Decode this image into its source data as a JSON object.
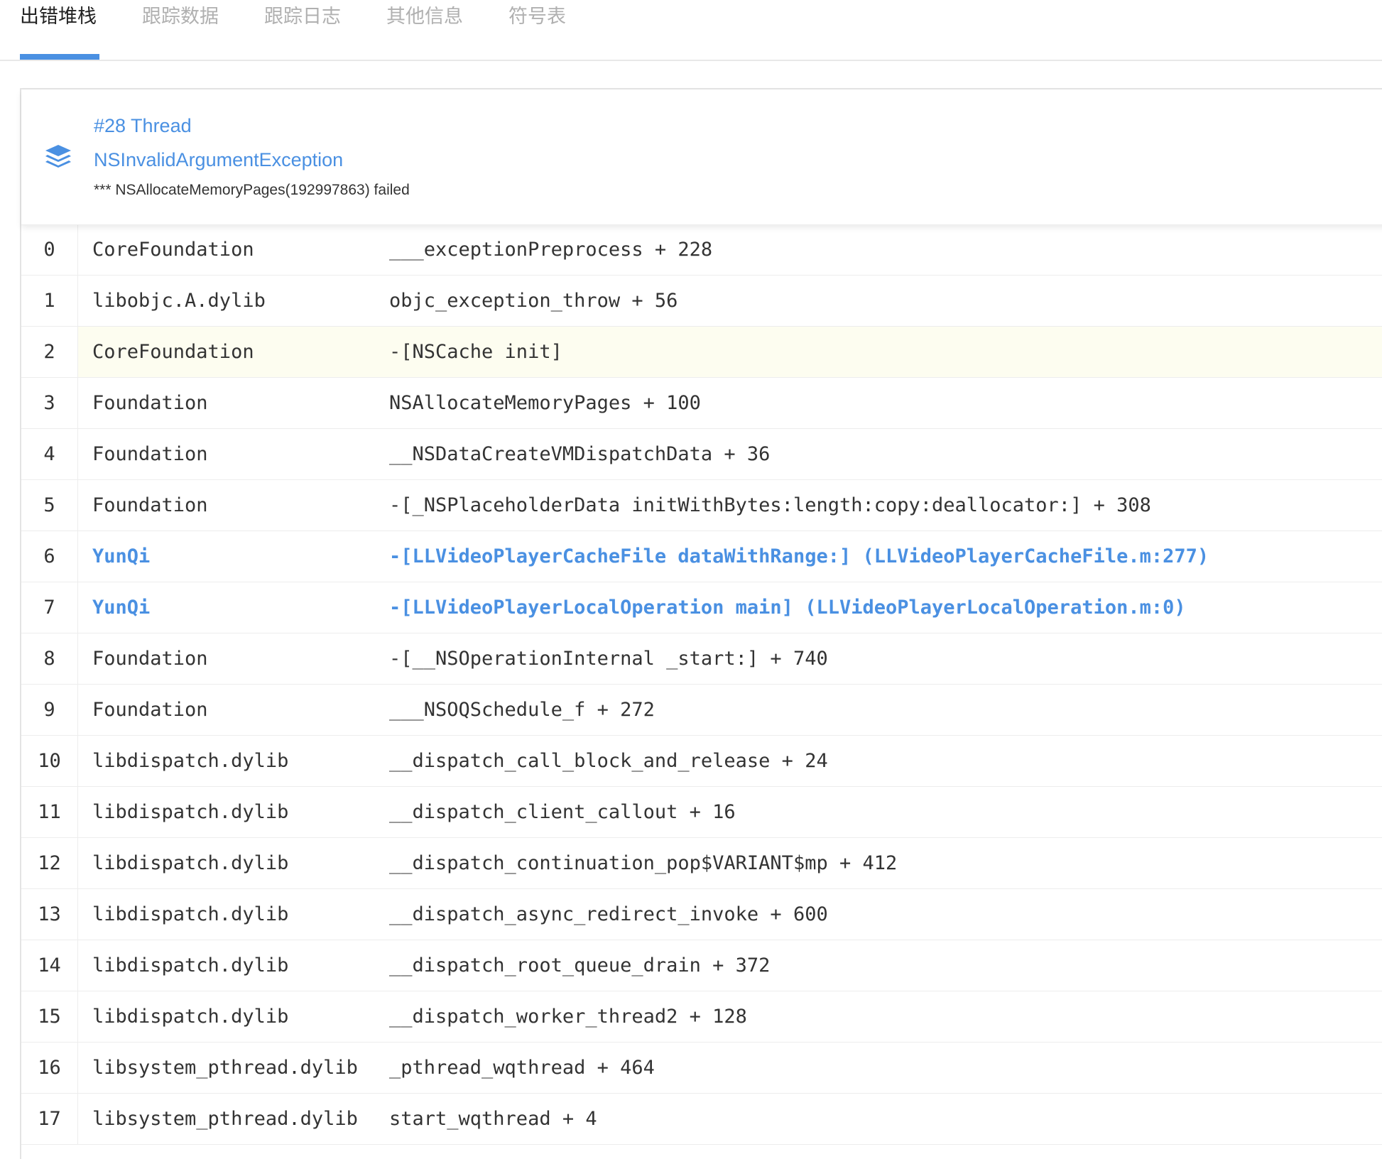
{
  "tabs": [
    {
      "label": "出错堆栈",
      "active": true
    },
    {
      "label": "跟踪数据",
      "active": false
    },
    {
      "label": "跟踪日志",
      "active": false
    },
    {
      "label": "其他信息",
      "active": false
    },
    {
      "label": "符号表",
      "active": false
    }
  ],
  "colors": {
    "accent": "#4a90e2",
    "highlight_row": "#fdfdf0",
    "text": "#333333",
    "tab_inactive": "#b0b0b0"
  },
  "thread": {
    "icon": "layers-icon",
    "title": "#28 Thread",
    "exception_name": "NSInvalidArgumentException",
    "exception_reason": "*** NSAllocateMemoryPages(192997863) failed"
  },
  "frames": [
    {
      "index": "0",
      "module": "CoreFoundation",
      "symbol": "___exceptionPreprocess + 228",
      "app": false,
      "highlight": false
    },
    {
      "index": "1",
      "module": "libobjc.A.dylib",
      "symbol": "objc_exception_throw + 56",
      "app": false,
      "highlight": false
    },
    {
      "index": "2",
      "module": "CoreFoundation",
      "symbol": "-[NSCache init]",
      "app": false,
      "highlight": true
    },
    {
      "index": "3",
      "module": "Foundation",
      "symbol": "NSAllocateMemoryPages + 100",
      "app": false,
      "highlight": false
    },
    {
      "index": "4",
      "module": "Foundation",
      "symbol": "__NSDataCreateVMDispatchData + 36",
      "app": false,
      "highlight": false
    },
    {
      "index": "5",
      "module": "Foundation",
      "symbol": "-[_NSPlaceholderData initWithBytes:length:copy:deallocator:] + 308",
      "app": false,
      "highlight": false
    },
    {
      "index": "6",
      "module": "YunQi",
      "symbol": "-[LLVideoPlayerCacheFile dataWithRange:] (LLVideoPlayerCacheFile.m:277)",
      "app": true,
      "highlight": false
    },
    {
      "index": "7",
      "module": "YunQi",
      "symbol": "-[LLVideoPlayerLocalOperation main] (LLVideoPlayerLocalOperation.m:0)",
      "app": true,
      "highlight": false
    },
    {
      "index": "8",
      "module": "Foundation",
      "symbol": "-[__NSOperationInternal _start:] + 740",
      "app": false,
      "highlight": false
    },
    {
      "index": "9",
      "module": "Foundation",
      "symbol": "___NSOQSchedule_f + 272",
      "app": false,
      "highlight": false
    },
    {
      "index": "10",
      "module": "libdispatch.dylib",
      "symbol": "__dispatch_call_block_and_release + 24",
      "app": false,
      "highlight": false
    },
    {
      "index": "11",
      "module": "libdispatch.dylib",
      "symbol": "__dispatch_client_callout + 16",
      "app": false,
      "highlight": false
    },
    {
      "index": "12",
      "module": "libdispatch.dylib",
      "symbol": "__dispatch_continuation_pop$VARIANT$mp + 412",
      "app": false,
      "highlight": false
    },
    {
      "index": "13",
      "module": "libdispatch.dylib",
      "symbol": "__dispatch_async_redirect_invoke + 600",
      "app": false,
      "highlight": false
    },
    {
      "index": "14",
      "module": "libdispatch.dylib",
      "symbol": "__dispatch_root_queue_drain + 372",
      "app": false,
      "highlight": false
    },
    {
      "index": "15",
      "module": "libdispatch.dylib",
      "symbol": "__dispatch_worker_thread2 + 128",
      "app": false,
      "highlight": false
    },
    {
      "index": "16",
      "module": "libsystem_pthread.dylib",
      "symbol": "_pthread_wqthread + 464",
      "app": false,
      "highlight": false
    },
    {
      "index": "17",
      "module": "libsystem_pthread.dylib",
      "symbol": "start_wqthread + 4",
      "app": false,
      "highlight": false
    }
  ]
}
